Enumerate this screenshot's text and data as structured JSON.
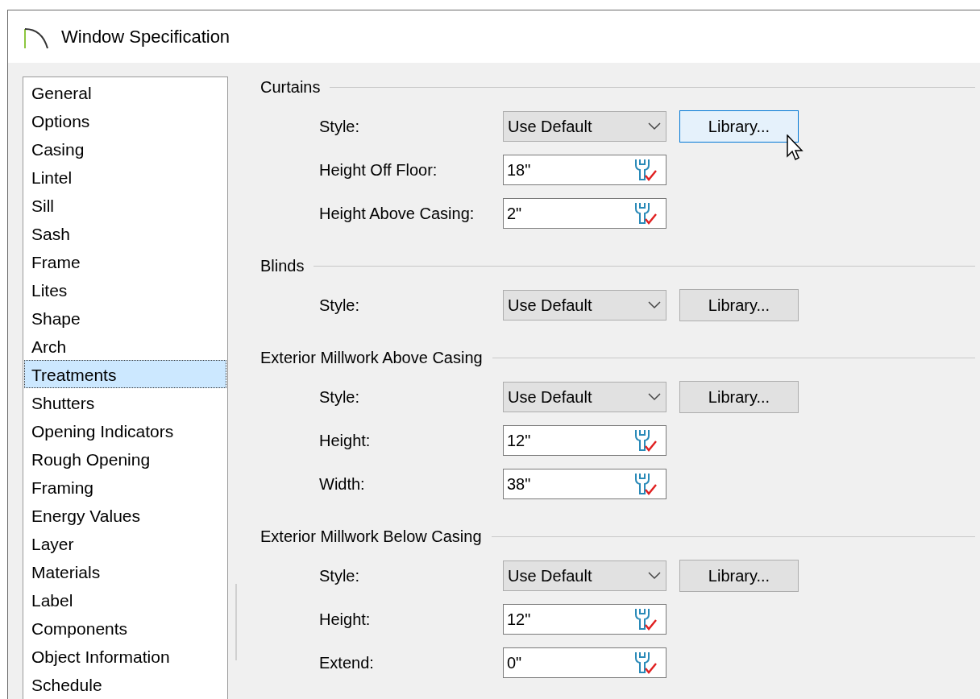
{
  "window": {
    "title": "Window Specification"
  },
  "sidebar": {
    "items": [
      {
        "label": "General",
        "selected": false
      },
      {
        "label": "Options",
        "selected": false
      },
      {
        "label": "Casing",
        "selected": false
      },
      {
        "label": "Lintel",
        "selected": false
      },
      {
        "label": "Sill",
        "selected": false
      },
      {
        "label": "Sash",
        "selected": false
      },
      {
        "label": "Frame",
        "selected": false
      },
      {
        "label": "Lites",
        "selected": false
      },
      {
        "label": "Shape",
        "selected": false
      },
      {
        "label": "Arch",
        "selected": false
      },
      {
        "label": "Treatments",
        "selected": true
      },
      {
        "label": "Shutters",
        "selected": false
      },
      {
        "label": "Opening Indicators",
        "selected": false
      },
      {
        "label": "Rough Opening",
        "selected": false
      },
      {
        "label": "Framing",
        "selected": false
      },
      {
        "label": "Energy Values",
        "selected": false
      },
      {
        "label": "Layer",
        "selected": false
      },
      {
        "label": "Materials",
        "selected": false
      },
      {
        "label": "Label",
        "selected": false
      },
      {
        "label": "Components",
        "selected": false
      },
      {
        "label": "Object Information",
        "selected": false
      },
      {
        "label": "Schedule",
        "selected": false
      }
    ]
  },
  "sections": [
    {
      "title": "Curtains",
      "rows": [
        {
          "kind": "select",
          "label": "Style:",
          "value": "Use Default",
          "button": {
            "label": "Library...",
            "hovered": true
          }
        },
        {
          "kind": "field",
          "label": "Height Off Floor:",
          "value": "18\""
        },
        {
          "kind": "field",
          "label": "Height Above Casing:",
          "value": "2\""
        }
      ]
    },
    {
      "title": "Blinds",
      "rows": [
        {
          "kind": "select",
          "label": "Style:",
          "value": "Use Default",
          "button": {
            "label": "Library...",
            "hovered": false
          }
        }
      ]
    },
    {
      "title": "Exterior Millwork Above Casing",
      "rows": [
        {
          "kind": "select",
          "label": "Style:",
          "value": "Use Default",
          "button": {
            "label": "Library...",
            "hovered": false
          }
        },
        {
          "kind": "field",
          "label": "Height:",
          "value": "12\""
        },
        {
          "kind": "field",
          "label": "Width:",
          "value": "38\""
        }
      ]
    },
    {
      "title": "Exterior Millwork Below Casing",
      "rows": [
        {
          "kind": "select",
          "label": "Style:",
          "value": "Use Default",
          "button": {
            "label": "Library...",
            "hovered": false
          }
        },
        {
          "kind": "field",
          "label": "Height:",
          "value": "12\""
        },
        {
          "kind": "field",
          "label": "Extend:",
          "value": "0\""
        }
      ]
    }
  ]
}
